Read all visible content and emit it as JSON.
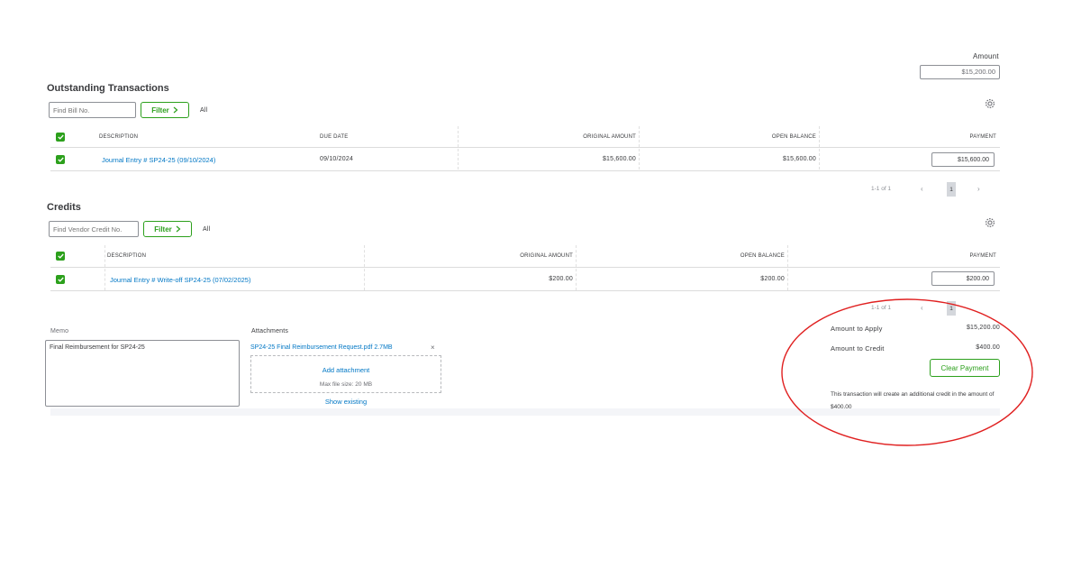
{
  "amount": {
    "label": "Amount",
    "value": "$15,200.00"
  },
  "outstanding": {
    "title": "Outstanding Transactions",
    "search_placeholder": "Find Bill No.",
    "filter_label": "Filter",
    "all_label": "All",
    "columns": [
      "DESCRIPTION",
      "DUE DATE",
      "ORIGINAL AMOUNT",
      "OPEN BALANCE",
      "PAYMENT"
    ],
    "rows": [
      {
        "description": "Journal Entry # SP24-25 (09/10/2024)",
        "due_date": "09/10/2024",
        "original_amount": "$15,600.00",
        "open_balance": "$15,600.00",
        "payment": "$15,600.00"
      }
    ],
    "pagination": {
      "range": "1-1 of 1",
      "page": "1"
    }
  },
  "credits": {
    "title": "Credits",
    "search_placeholder": "Find Vendor Credit No.",
    "filter_label": "Filter",
    "all_label": "All",
    "columns": [
      "DESCRIPTION",
      "ORIGINAL AMOUNT",
      "OPEN BALANCE",
      "PAYMENT"
    ],
    "rows": [
      {
        "description": "Journal Entry # Write-off SP24-25 (07/02/2025)",
        "original_amount": "$200.00",
        "open_balance": "$200.00",
        "payment": "$200.00"
      }
    ],
    "pagination": {
      "range": "1-1 of 1",
      "page": "1"
    }
  },
  "memo": {
    "label": "Memo",
    "value": "Final Reimbursement for SP24-25"
  },
  "attachments": {
    "label": "Attachments",
    "file_name": "SP24-25 Final Reimbursement Request.pdf 2.7MB",
    "add_label": "Add attachment",
    "max_size": "Max file size: 20 MB",
    "show_existing": "Show existing"
  },
  "summary": {
    "apply_label": "Amount to Apply",
    "apply_value": "$15,200.00",
    "credit_label": "Amount to Credit",
    "credit_value": "$400.00",
    "clear_label": "Clear Payment",
    "note": "This transaction will create an additional credit in the amount of $400.00"
  },
  "colors": {
    "accent": "#2ca01c",
    "link": "#0077c5",
    "highlight": "#e02020"
  },
  "icons": [
    "gear-icon",
    "chevron-right-icon",
    "checkmark-icon",
    "close-icon"
  ]
}
